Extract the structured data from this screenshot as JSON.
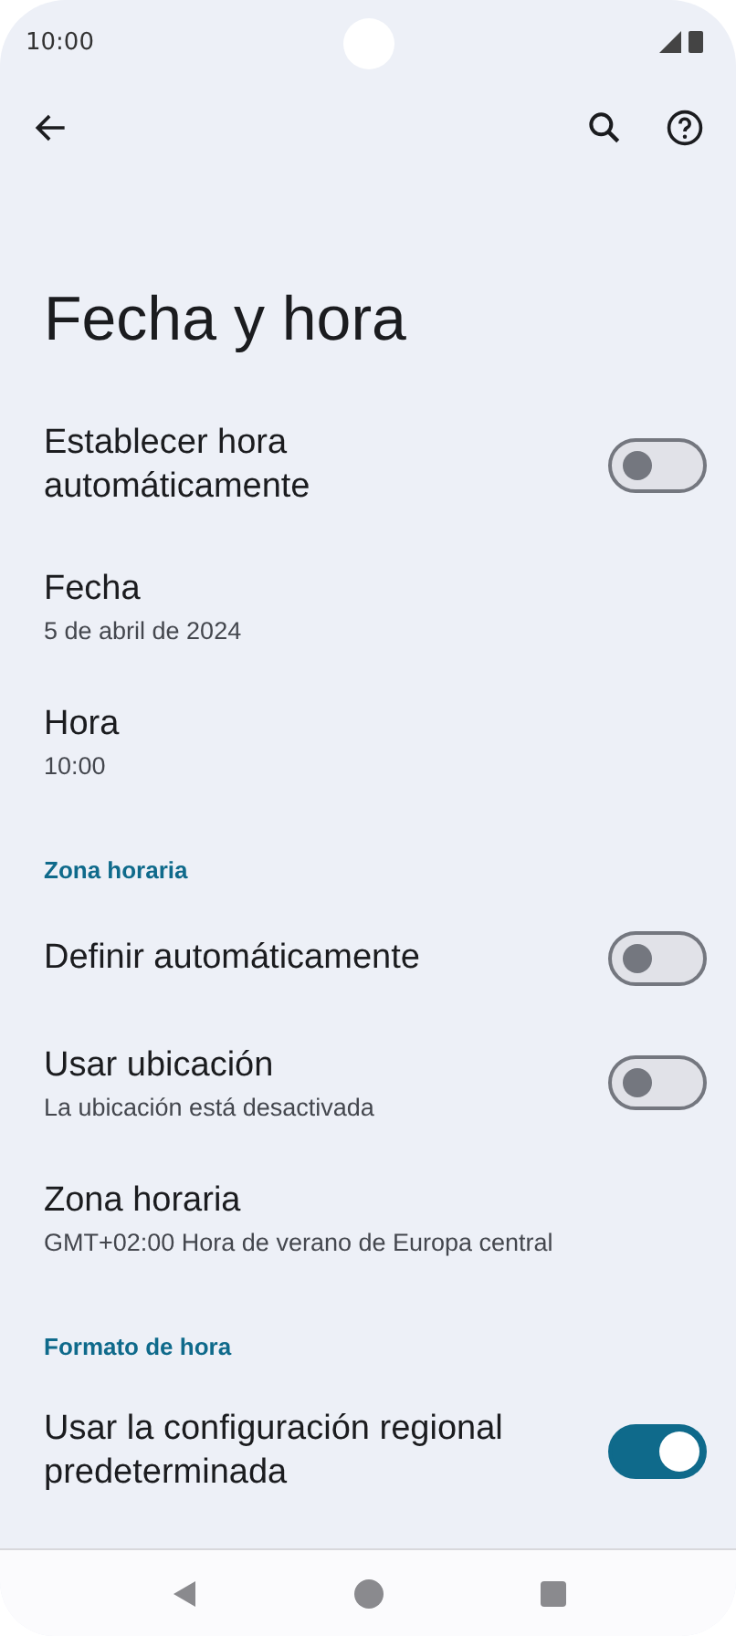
{
  "status_bar": {
    "time": "10:00"
  },
  "title": "Fecha y hora",
  "items": [
    {
      "kind": "switch",
      "title": "Establecer hora automáticamente",
      "on": false
    },
    {
      "kind": "setting",
      "title": "Fecha",
      "summary": "5 de abril de 2024"
    },
    {
      "kind": "setting",
      "title": "Hora",
      "summary": "10:00"
    },
    {
      "kind": "header",
      "title": "Zona horaria"
    },
    {
      "kind": "switch",
      "title": "Definir automáticamente",
      "on": false
    },
    {
      "kind": "switch",
      "title": "Usar ubicación",
      "summary": "La ubicación está desactivada",
      "on": false
    },
    {
      "kind": "setting",
      "title": "Zona horaria",
      "summary": "GMT+02:00 Hora de verano de Europa central"
    },
    {
      "kind": "header",
      "title": "Formato de hora"
    },
    {
      "kind": "switch",
      "title": "Usar la configuración regional predeterminada",
      "on": true
    }
  ]
}
